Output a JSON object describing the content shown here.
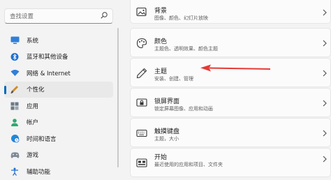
{
  "search": {
    "placeholder": "查找设置"
  },
  "nav": {
    "items": [
      {
        "label": "系统",
        "icon": "monitor-icon"
      },
      {
        "label": "蓝牙和其他设备",
        "icon": "bluetooth-icon"
      },
      {
        "label": "网络 & Internet",
        "icon": "wifi-icon"
      },
      {
        "label": "个性化",
        "icon": "brush-icon",
        "active": true
      },
      {
        "label": "应用",
        "icon": "apps-icon"
      },
      {
        "label": "帐户",
        "icon": "account-icon"
      },
      {
        "label": "时间和语言",
        "icon": "globe-clock-icon"
      },
      {
        "label": "游戏",
        "icon": "game-controller-icon"
      },
      {
        "label": "辅助功能",
        "icon": "accessibility-icon"
      }
    ]
  },
  "cards": [
    {
      "title": "背景",
      "subtitle": "图像、颜色、幻灯片放映",
      "icon": "image-icon"
    },
    {
      "title": "颜色",
      "subtitle": "主题色、透明效果、颜色主题",
      "icon": "palette-icon"
    },
    {
      "title": "主题",
      "subtitle": "安装、创建、管理",
      "icon": "pen-icon"
    },
    {
      "title": "锁屏界面",
      "subtitle": "锁定屏幕图像、应用和动画",
      "icon": "lock-screen-icon"
    },
    {
      "title": "触摸键盘",
      "subtitle": "主题，大小",
      "icon": "keyboard-icon"
    },
    {
      "title": "开始",
      "subtitle": "最近使用的应用和项目、文件夹",
      "icon": "start-icon"
    }
  ],
  "colors": {
    "accent": "#0067c0",
    "annotation_arrow": "#e53935"
  }
}
